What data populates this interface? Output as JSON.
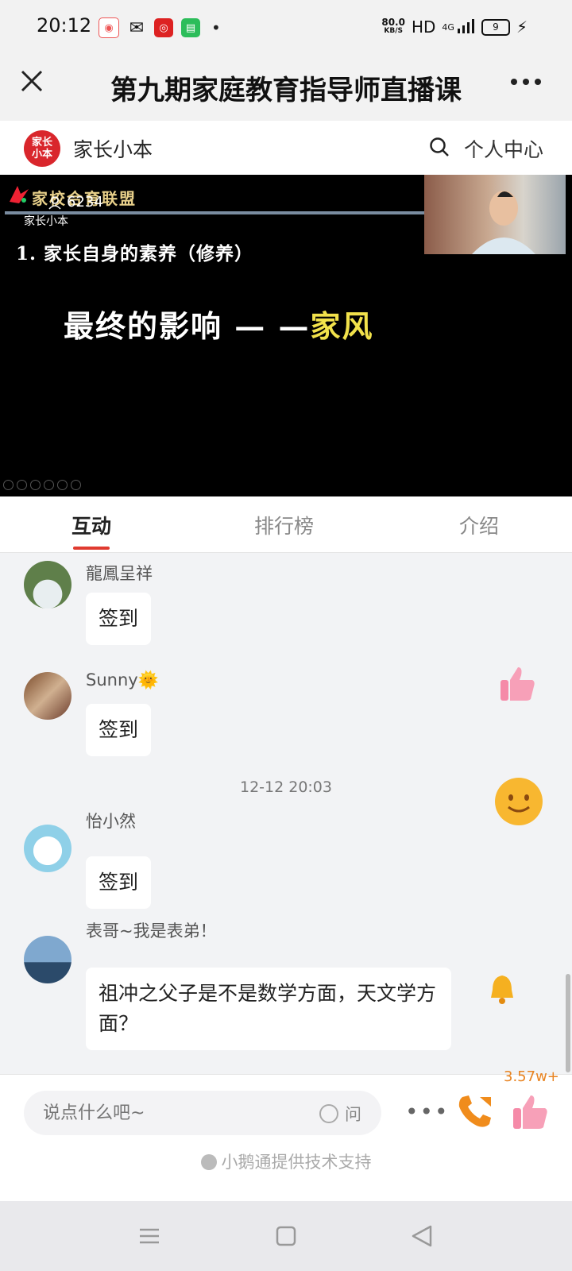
{
  "status_bar": {
    "time": "20:12",
    "speed_value": "80.0",
    "speed_unit": "KB/S",
    "hd": "HD",
    "network": "4G",
    "battery": "9"
  },
  "header": {
    "title": "第九期家庭教育指导师直播课"
  },
  "brand": {
    "logo_text_1": "家长",
    "logo_text_2": "小本",
    "name": "家长小本",
    "personal_center": "个人中心"
  },
  "video": {
    "alliance_text": "家校合育联盟",
    "watermark": "家长小本",
    "viewer_count": "6234",
    "slide_heading": "1. 家长自身的素养（修养）",
    "slide_main": "最终的影响 — —",
    "slide_highlight": "家风"
  },
  "tabs": [
    {
      "label": "互动"
    },
    {
      "label": "排行榜"
    },
    {
      "label": "介绍"
    }
  ],
  "messages": [
    {
      "user": "龍鳳呈祥",
      "text": "签到"
    },
    {
      "user": "Sunny🌞",
      "text": "签到"
    },
    {
      "user": "怡小然",
      "text": "签到"
    },
    {
      "user": "表哥~我是表弟！",
      "text": "祖冲之父子是不是数学方面，天文学方面？"
    }
  ],
  "timestamp": "12-12 20:03",
  "input": {
    "placeholder": "说点什么吧~",
    "ask_label": "问"
  },
  "likes": {
    "count": "3.57w+"
  },
  "support_text": "小鹅通提供技术支持",
  "colors": {
    "accent": "#e03a2f",
    "brand": "#d9262c",
    "like_count": "#e88320"
  },
  "icons": [
    "close-icon",
    "more-icon",
    "search-icon",
    "user-icon",
    "thumbs-up-icon",
    "smile-emoji-icon",
    "bell-icon",
    "phone-call-icon",
    "menu-icon",
    "home-icon",
    "back-icon"
  ]
}
